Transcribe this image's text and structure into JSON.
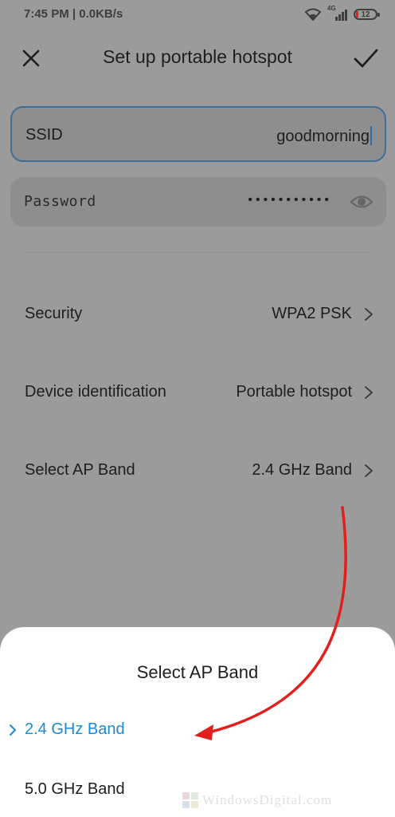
{
  "status_bar": {
    "time": "7:45 PM | 0.0KB/s",
    "network_type": "4G",
    "battery_level": "12",
    "battery_fraction": 0.12,
    "icons": [
      "wifi-icon",
      "signal-icon",
      "battery-icon"
    ]
  },
  "header": {
    "title": "Set up portable hotspot",
    "close_icon": "close-icon",
    "confirm_icon": "checkmark-icon"
  },
  "ssid": {
    "label": "SSID",
    "value": "goodmorning"
  },
  "password": {
    "label": "Password",
    "value_masked": "•••••••••••",
    "visibility_icon": "eye-icon"
  },
  "settings": [
    {
      "label": "Security",
      "value": "WPA2 PSK"
    },
    {
      "label": "Device identification",
      "value": "Portable hotspot"
    },
    {
      "label": "Select AP Band",
      "value": "2.4 GHz Band"
    }
  ],
  "sheet": {
    "title": "Select AP Band",
    "options": [
      {
        "label": "2.4 GHz Band",
        "selected": true
      },
      {
        "label": "5.0 GHz Band",
        "selected": false
      }
    ]
  },
  "watermark": "WindowsDigital.com",
  "colors": {
    "accent": "#1a8ad4",
    "focus_border": "#3f6f98",
    "annotation_arrow": "#e0201e",
    "overlay_background": "#9b9b9b"
  }
}
